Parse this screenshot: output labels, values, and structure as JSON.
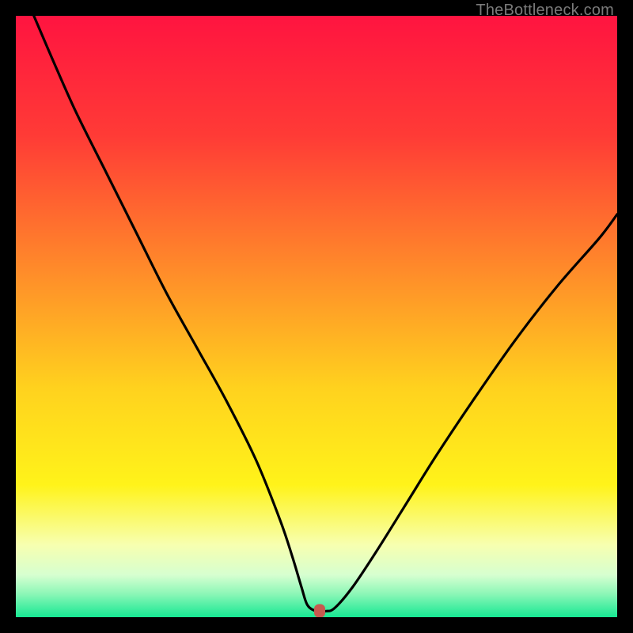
{
  "watermark": "TheBottleneck.com",
  "colors": {
    "bg": "#000000",
    "marker": "#c65a4f",
    "gradient_stops": [
      {
        "p": 0,
        "c": "#ff1440"
      },
      {
        "p": 20,
        "c": "#ff3b36"
      },
      {
        "p": 42,
        "c": "#ff8a2a"
      },
      {
        "p": 62,
        "c": "#ffd21e"
      },
      {
        "p": 78,
        "c": "#fff31a"
      },
      {
        "p": 88,
        "c": "#f7ffb0"
      },
      {
        "p": 93,
        "c": "#d6ffd0"
      },
      {
        "p": 96,
        "c": "#8ff7b8"
      },
      {
        "p": 100,
        "c": "#17e893"
      }
    ]
  },
  "chart_data": {
    "type": "line",
    "title": "",
    "xlabel": "",
    "ylabel": "",
    "xlim": [
      0,
      100
    ],
    "ylim": [
      0,
      100
    ],
    "grid": false,
    "legend": false,
    "series": [
      {
        "name": "bottleneck-curve",
        "x": [
          3,
          6,
          10,
          15,
          20,
          25,
          30,
          35,
          40,
          44,
          46,
          47.5,
          48.5,
          50,
          51.5,
          53,
          56,
          60,
          65,
          70,
          76,
          83,
          90,
          97,
          100
        ],
        "y": [
          100,
          93,
          84,
          74,
          64,
          54,
          45,
          36,
          26,
          16,
          10,
          5,
          2,
          1,
          1,
          1.5,
          5,
          11,
          19,
          27,
          36,
          46,
          55,
          63,
          67
        ]
      }
    ],
    "marker": {
      "x": 50.5,
      "y": 1
    },
    "annotations": []
  }
}
